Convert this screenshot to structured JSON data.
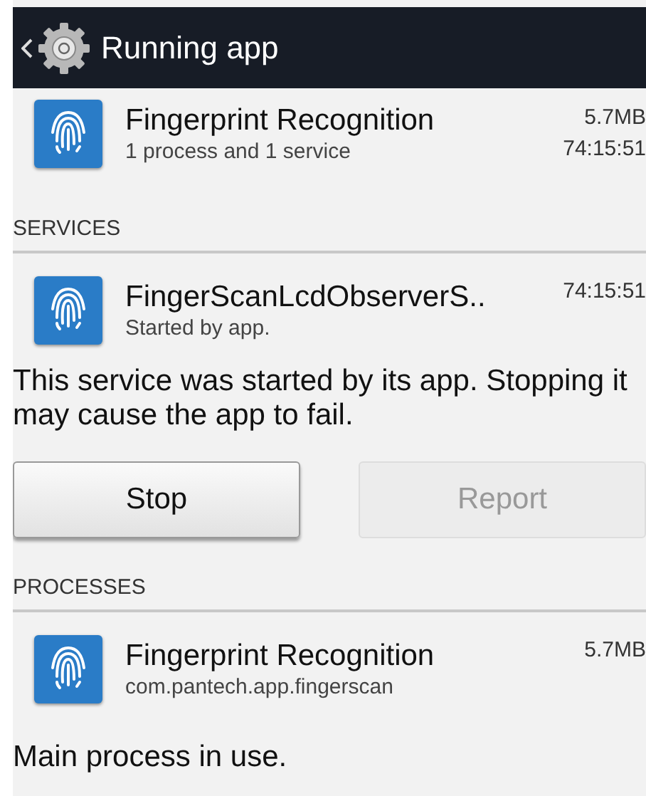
{
  "header": {
    "title": "Running app"
  },
  "app": {
    "name": "Fingerprint Recognition",
    "subtitle": "1 process and 1 service",
    "size": "5.7MB",
    "time": "74:15:51"
  },
  "services": {
    "heading": "SERVICES",
    "items": [
      {
        "name": "FingerScanLcdObserverS..",
        "subtitle": "Started by app.",
        "time": "74:15:51"
      }
    ],
    "description": "This service was started by its app. Stopping it may cause the app to fail.",
    "buttons": [
      {
        "label": "Stop",
        "disabled": false
      },
      {
        "label": "Report",
        "disabled": true
      }
    ]
  },
  "processes": {
    "heading": "PROCESSES",
    "items": [
      {
        "name": "Fingerprint Recognition",
        "subtitle": "com.pantech.app.fingerscan",
        "size": "5.7MB"
      }
    ],
    "description": "Main process in use."
  }
}
